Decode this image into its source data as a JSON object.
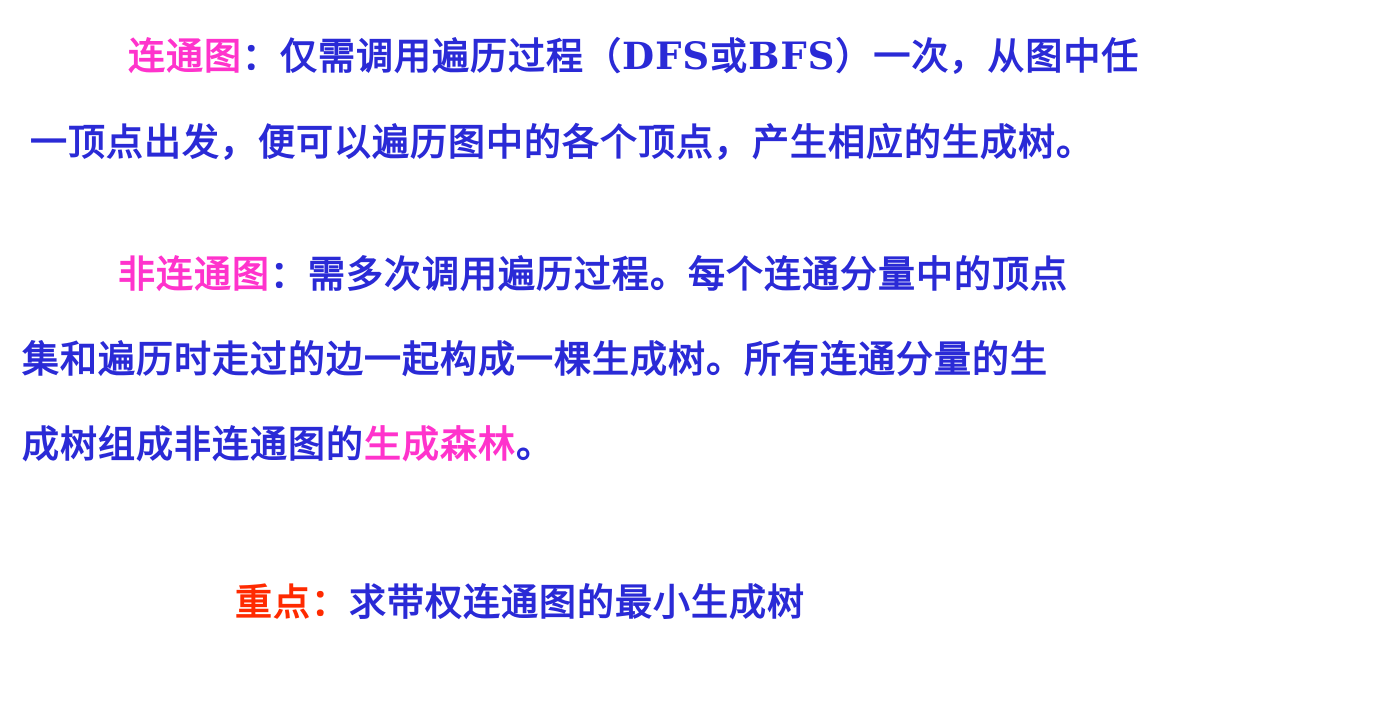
{
  "paragraph1": {
    "term": "连通图",
    "colon": "：",
    "line1_rest": "仅需调用遍历过程（DFS或BFS）一次，从图中任",
    "line2": "一顶点出发，便可以遍历图中的各个顶点，产生相应的生成树。"
  },
  "paragraph2": {
    "term": "非连通图",
    "colon": "：",
    "line1_rest": "需多次调用遍历过程。每个连通分量中的顶点",
    "line2": "集和遍历时走过的边一起构成一棵生成树。所有连通分量的生",
    "line3_prefix": "成树组成非连通图的",
    "line3_highlight": "生成森林",
    "line3_suffix": "。"
  },
  "key_point": {
    "label": "重点：",
    "text": "求带权连通图的最小生成树"
  },
  "colors": {
    "body_text": "#2a2ad6",
    "term_highlight": "#ff33cc",
    "key_label": "#ff2a00"
  }
}
